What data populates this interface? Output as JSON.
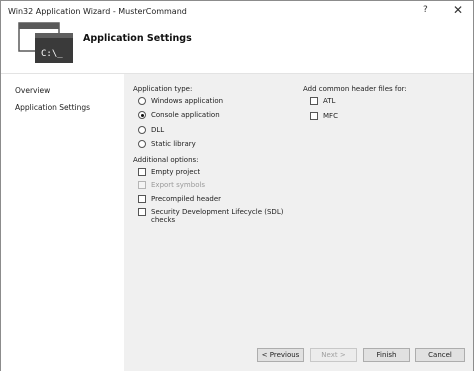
{
  "window": {
    "title": "Win32 Application Wizard - MusterCommand",
    "help_label": "?",
    "close_label": "✕"
  },
  "banner": {
    "title": "Application Settings",
    "icon": "console-window-icon",
    "icon_text": "C:\\_"
  },
  "nav": {
    "items": [
      {
        "label": "Overview"
      },
      {
        "label": "Application Settings"
      }
    ]
  },
  "app_type": {
    "label": "Application type:",
    "options": [
      {
        "label": "Windows application",
        "selected": false
      },
      {
        "label": "Console application",
        "selected": true
      },
      {
        "label": "DLL",
        "selected": false
      },
      {
        "label": "Static library",
        "selected": false
      }
    ]
  },
  "additional": {
    "label": "Additional options:",
    "options": [
      {
        "label": "Empty project",
        "checked": false,
        "enabled": true
      },
      {
        "label": "Export symbols",
        "checked": false,
        "enabled": false
      },
      {
        "label": "Precompiled header",
        "checked": false,
        "enabled": true
      },
      {
        "label": "Security Development Lifecycle (SDL) checks",
        "line1": "Security Development Lifecycle (SDL)",
        "line2": "checks",
        "checked": false,
        "enabled": true
      }
    ]
  },
  "headers": {
    "label": "Add common header files for:",
    "options": [
      {
        "label": "ATL",
        "checked": false
      },
      {
        "label": "MFC",
        "checked": false
      }
    ]
  },
  "buttons": {
    "previous": "< Previous",
    "next": "Next >",
    "finish": "Finish",
    "cancel": "Cancel"
  },
  "colors": {
    "content_background": "#f0f0f0",
    "icon_dark": "#3a3a3a",
    "icon_frame": "#5a5a5a"
  }
}
